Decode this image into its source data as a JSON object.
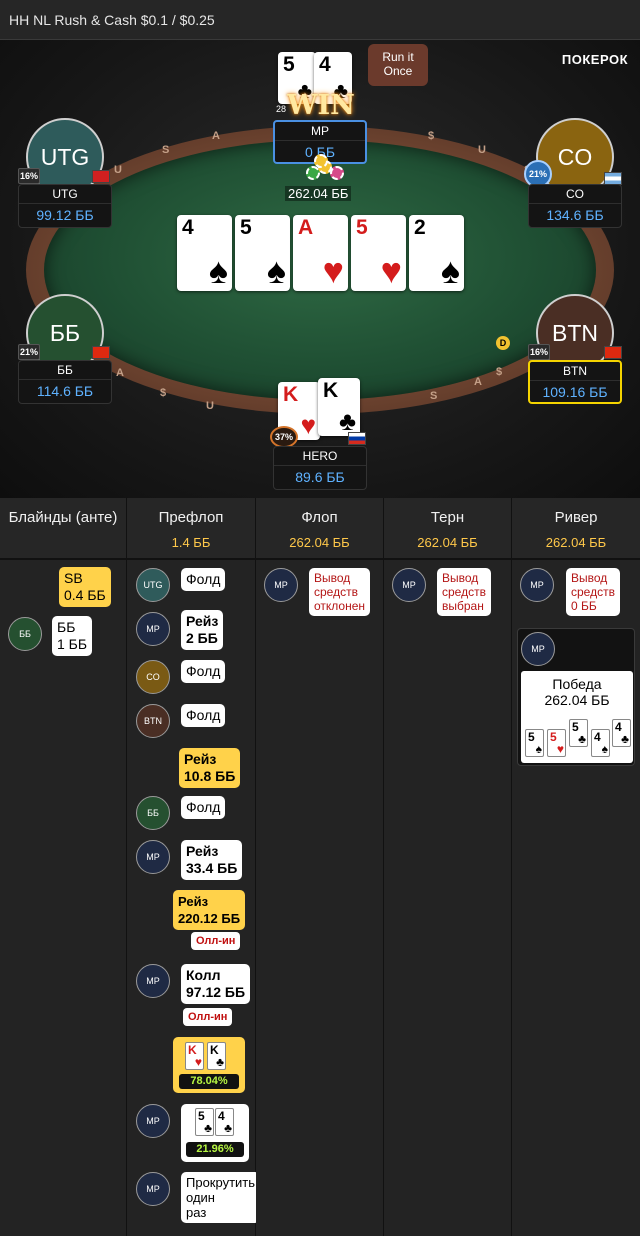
{
  "window": {
    "title": "HH NL Rush & Cash $0.1 / $0.25"
  },
  "brand": "ПОКЕРОК",
  "table": {
    "rail_letters": [
      "U",
      "S",
      "A",
      "$",
      "U",
      "S",
      "A",
      "$",
      "U",
      "S",
      "A",
      "$"
    ],
    "pot": "262.04 ББ",
    "run_it_once": "Run it Once",
    "win_badge": "WIN",
    "win_count": "28",
    "board": [
      {
        "rank": "4",
        "suit": "♠",
        "color": "black"
      },
      {
        "rank": "5",
        "suit": "♠",
        "color": "black"
      },
      {
        "rank": "A",
        "suit": "♥",
        "color": "red"
      },
      {
        "rank": "5",
        "suit": "♥",
        "color": "red"
      },
      {
        "rank": "2",
        "suit": "♠",
        "color": "black"
      }
    ],
    "seats": {
      "mp": {
        "name": "MP",
        "stack": "0 ББ",
        "cards": [
          {
            "rank": "5",
            "suit": "♣"
          },
          {
            "rank": "4",
            "suit": "♣"
          }
        ]
      },
      "utg": {
        "avatar": "UTG",
        "name": "UTG",
        "stack": "99.12 ББ",
        "pct": "16%"
      },
      "co": {
        "avatar": "CO",
        "name": "CO",
        "stack": "134.6 ББ",
        "pct": "21%"
      },
      "bb": {
        "avatar": "ББ",
        "name": "ББ",
        "stack": "114.6 ББ",
        "pct": "21%"
      },
      "btn": {
        "avatar": "BTN",
        "name": "BTN",
        "stack": "109.16 ББ",
        "pct": "16%",
        "dealer": "D"
      },
      "hero": {
        "name": "HERO",
        "stack": "89.6 ББ",
        "pct": "37%",
        "cards": [
          {
            "rank": "K",
            "suit": "♥",
            "color": "red"
          },
          {
            "rank": "K",
            "suit": "♣",
            "color": "black"
          }
        ]
      }
    }
  },
  "history": {
    "columns": [
      {
        "title": "Блайнды (анте)",
        "amount": ""
      },
      {
        "title": "Префлоп",
        "amount": "1.4 ББ"
      },
      {
        "title": "Флоп",
        "amount": "262.04 ББ"
      },
      {
        "title": "Терн",
        "amount": "262.04 ББ"
      },
      {
        "title": "Ривер",
        "amount": "262.04 ББ"
      }
    ],
    "blinds": {
      "sb_line1": "SB",
      "sb_line2": "0.4 ББ",
      "bb_pos": "ББ",
      "bb_line1": "ББ",
      "bb_line2": "1 ББ"
    },
    "preflop": {
      "utg_pos": "UTG",
      "utg_action": "Фолд",
      "mp_pos": "MP",
      "mp_raise1_l1": "Рейз",
      "mp_raise1_l2": "2 ББ",
      "co_pos": "CO",
      "co_action": "Фолд",
      "btn_pos": "BTN",
      "btn_action": "Фолд",
      "hero_raise1_l1": "Рейз",
      "hero_raise1_l2": "10.8 ББ",
      "bb_pos": "ББ",
      "bb_action": "Фолд",
      "mp_raise2_l1": "Рейз",
      "mp_raise2_l2": "33.4 ББ",
      "hero_raise2_l1": "Рейз",
      "hero_raise2_l2": "220.12 ББ",
      "hero_allin": "Олл-ин",
      "mp_call_l1": "Колл",
      "mp_call_l2": "97.12 ББ",
      "mp_allin": "Олл-ин",
      "hero_equity": "78.04%",
      "mp_equity": "21.96%",
      "mp_run_l1": "Прокрутить",
      "mp_run_l2": "один",
      "mp_run_l3": "раз"
    },
    "flop": {
      "pos": "MP",
      "l1": "Вывод",
      "l2": "средств",
      "l3": "отклонен"
    },
    "turn": {
      "pos": "MP",
      "l1": "Вывод",
      "l2": "средств",
      "l3": "выбран"
    },
    "river": {
      "pos": "MP",
      "l1": "Вывод",
      "l2": "средств",
      "l3": "0 ББ",
      "win_pos": "MP",
      "win_l1": "Победа",
      "win_l2": "262.04 ББ",
      "win_cards": [
        {
          "rank": "5",
          "suit": "♠",
          "color": "black"
        },
        {
          "rank": "5",
          "suit": "♥",
          "color": "red"
        },
        {
          "rank": "5",
          "suit": "♣",
          "color": "black"
        },
        {
          "rank": "4",
          "suit": "♠",
          "color": "black"
        },
        {
          "rank": "4",
          "suit": "♣",
          "color": "black"
        }
      ]
    }
  }
}
